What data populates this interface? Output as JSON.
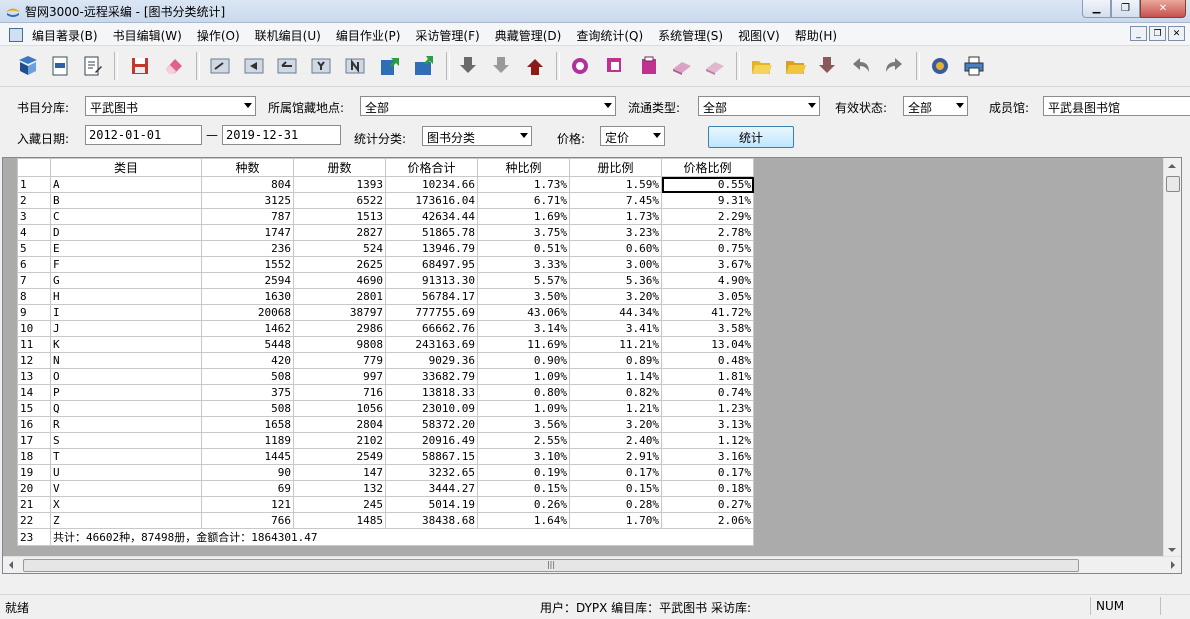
{
  "window": {
    "title": "智网3000-远程采编 - [图书分类统计]"
  },
  "menu": [
    "编目著录(B)",
    "书目编辑(W)",
    "操作(O)",
    "联机编目(U)",
    "编目作业(P)",
    "采访管理(F)",
    "典藏管理(D)",
    "查询统计(Q)",
    "系统管理(S)",
    "视图(V)",
    "帮助(H)"
  ],
  "filters": {
    "catalog_label": "书目分库:",
    "catalog_value": "平武图书",
    "location_label": "所属馆藏地点:",
    "location_value": "全部",
    "circ_label": "流通类型:",
    "circ_value": "全部",
    "status_label": "有效状态:",
    "status_value": "全部",
    "member_label": "成员馆:",
    "member_value": "平武县图书馆",
    "date_label": "入藏日期:",
    "date_from": "2012-01-01",
    "date_sep": "—",
    "date_to": "2019-12-31",
    "stat_class_label": "统计分类:",
    "stat_class_value": "图书分类",
    "price_label": "价格:",
    "price_value": "定价",
    "stat_button": "统计"
  },
  "table": {
    "headers": [
      "类目",
      "种数",
      "册数",
      "价格合计",
      "种比例",
      "册比例",
      "价格比例"
    ],
    "rows": [
      [
        "1",
        "A",
        "804",
        "1393",
        "10234.66",
        "1.73%",
        "1.59%",
        "0.55%"
      ],
      [
        "2",
        "B",
        "3125",
        "6522",
        "173616.04",
        "6.71%",
        "7.45%",
        "9.31%"
      ],
      [
        "3",
        "C",
        "787",
        "1513",
        "42634.44",
        "1.69%",
        "1.73%",
        "2.29%"
      ],
      [
        "4",
        "D",
        "1747",
        "2827",
        "51865.78",
        "3.75%",
        "3.23%",
        "2.78%"
      ],
      [
        "5",
        "E",
        "236",
        "524",
        "13946.79",
        "0.51%",
        "0.60%",
        "0.75%"
      ],
      [
        "6",
        "F",
        "1552",
        "2625",
        "68497.95",
        "3.33%",
        "3.00%",
        "3.67%"
      ],
      [
        "7",
        "G",
        "2594",
        "4690",
        "91313.30",
        "5.57%",
        "5.36%",
        "4.90%"
      ],
      [
        "8",
        "H",
        "1630",
        "2801",
        "56784.17",
        "3.50%",
        "3.20%",
        "3.05%"
      ],
      [
        "9",
        "I",
        "20068",
        "38797",
        "777755.69",
        "43.06%",
        "44.34%",
        "41.72%"
      ],
      [
        "10",
        "J",
        "1462",
        "2986",
        "66662.76",
        "3.14%",
        "3.41%",
        "3.58%"
      ],
      [
        "11",
        "K",
        "5448",
        "9808",
        "243163.69",
        "11.69%",
        "11.21%",
        "13.04%"
      ],
      [
        "12",
        "N",
        "420",
        "779",
        "9029.36",
        "0.90%",
        "0.89%",
        "0.48%"
      ],
      [
        "13",
        "O",
        "508",
        "997",
        "33682.79",
        "1.09%",
        "1.14%",
        "1.81%"
      ],
      [
        "14",
        "P",
        "375",
        "716",
        "13818.33",
        "0.80%",
        "0.82%",
        "0.74%"
      ],
      [
        "15",
        "Q",
        "508",
        "1056",
        "23010.09",
        "1.09%",
        "1.21%",
        "1.23%"
      ],
      [
        "16",
        "R",
        "1658",
        "2804",
        "58372.20",
        "3.56%",
        "3.20%",
        "3.13%"
      ],
      [
        "17",
        "S",
        "1189",
        "2102",
        "20916.49",
        "2.55%",
        "2.40%",
        "1.12%"
      ],
      [
        "18",
        "T",
        "1445",
        "2549",
        "58867.15",
        "3.10%",
        "2.91%",
        "3.16%"
      ],
      [
        "19",
        "U",
        "90",
        "147",
        "3232.65",
        "0.19%",
        "0.17%",
        "0.17%"
      ],
      [
        "20",
        "V",
        "69",
        "132",
        "3444.27",
        "0.15%",
        "0.15%",
        "0.18%"
      ],
      [
        "21",
        "X",
        "121",
        "245",
        "5014.19",
        "0.26%",
        "0.28%",
        "0.27%"
      ],
      [
        "22",
        "Z",
        "766",
        "1485",
        "38438.68",
        "1.64%",
        "1.70%",
        "2.06%"
      ]
    ],
    "total_rownum": "23",
    "total_text": "共计：46602种，87498册，金额合计：1864301.47"
  },
  "status": {
    "left": "就绪",
    "middle": "用户：DYPX 编目库：平武图书 采访库:",
    "right": "NUM"
  }
}
